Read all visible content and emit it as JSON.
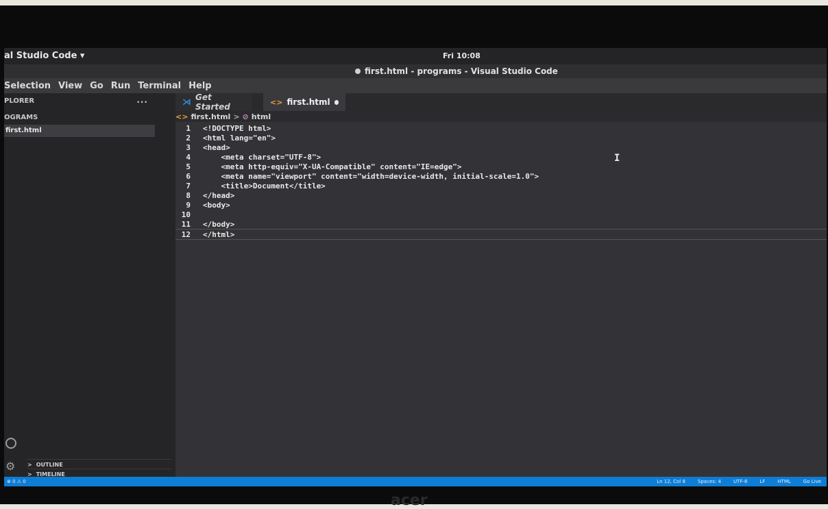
{
  "topbar": {
    "app_menu": "al Studio Code ▾",
    "clock": "Fri 10:08"
  },
  "window": {
    "title": "first.html - programs - Visual Studio Code"
  },
  "menubar": [
    "Selection",
    "View",
    "Go",
    "Run",
    "Terminal",
    "Help"
  ],
  "sidebar": {
    "header": "PLORER",
    "more": "···",
    "folder": "OGRAMS",
    "file": "first.html",
    "outline": "OUTLINE",
    "timeline": "TIMELINE"
  },
  "tabs": [
    {
      "label": "Get Started",
      "active": false
    },
    {
      "label": "first.html",
      "active": true,
      "modified": true
    }
  ],
  "breadcrumb": {
    "file": "first.html",
    "symbol": "html"
  },
  "editor": {
    "lines": [
      {
        "n": "1",
        "text": "<!DOCTYPE html>"
      },
      {
        "n": "2",
        "text": "<html lang=\"en\">"
      },
      {
        "n": "3",
        "text": "<head>"
      },
      {
        "n": "4",
        "text": "    <meta charset=\"UTF-8\">"
      },
      {
        "n": "5",
        "text": "    <meta http-equiv=\"X-UA-Compatible\" content=\"IE=edge\">"
      },
      {
        "n": "6",
        "text": "    <meta name=\"viewport\" content=\"width=device-width, initial-scale=1.0\">"
      },
      {
        "n": "7",
        "text": "    <title>Document</title>"
      },
      {
        "n": "8",
        "text": "</head>"
      },
      {
        "n": "9",
        "text": "<body>"
      },
      {
        "n": "10",
        "text": ""
      },
      {
        "n": "11",
        "text": "</body>"
      },
      {
        "n": "12",
        "text": "</html>"
      }
    ]
  },
  "statusbar": {
    "left": "⊗ 0 ⚠ 0",
    "items": [
      "Ln 12, Col 8",
      "Spaces: 4",
      "UTF-8",
      "LF",
      "HTML",
      "Go Live"
    ]
  },
  "bezel_logo": "acer",
  "colors": {
    "statusbar": "#0e7dd6",
    "editor_bg": "#333337",
    "sidebar_bg": "#252528"
  }
}
